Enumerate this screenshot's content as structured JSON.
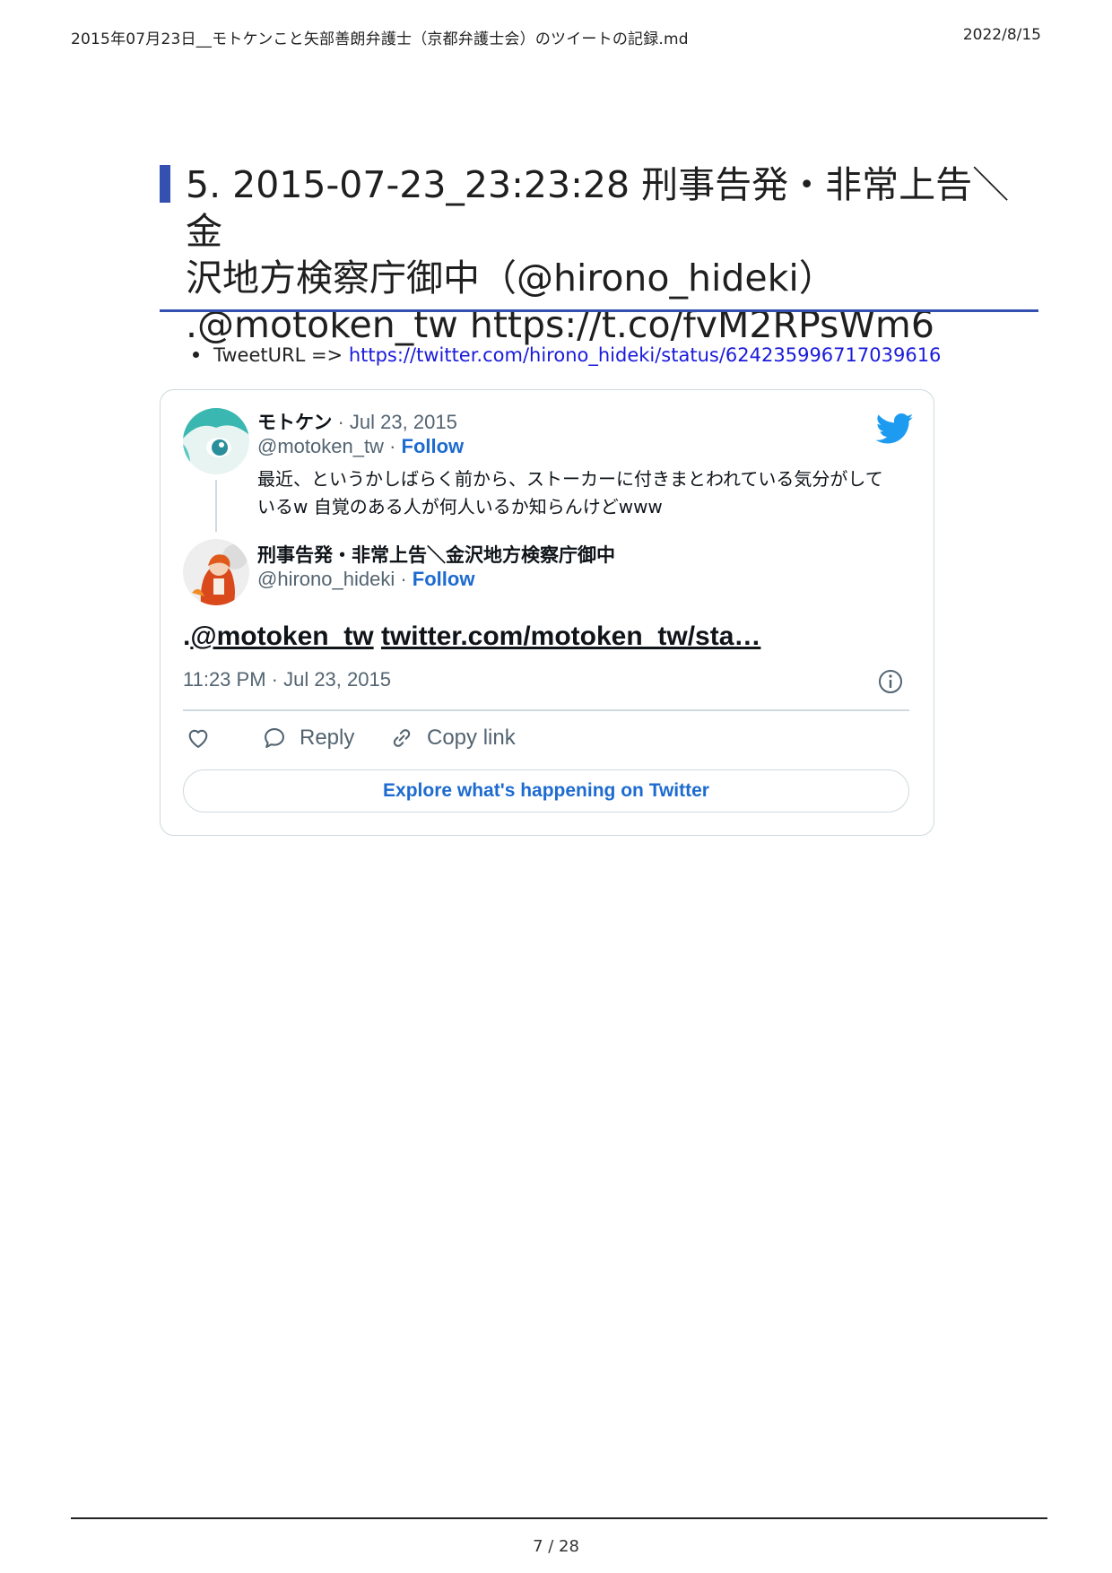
{
  "header": {
    "doc_title": "2015年07月23日__モトケンこと矢部善朗弁護士（京都弁護士会）のツイートの記録.md",
    "date": "2022/8/15"
  },
  "section": {
    "title_line1": "5. 2015-07-23_23:23:28 刑事告発・非常上告＼金",
    "title_line2": "沢地方検察庁御中（@hirono_hideki）",
    "title_line3": ".@motoken_tw https://t.co/fvM2RPsWm6"
  },
  "bullet": {
    "label": "TweetURL => ",
    "url": "https://twitter.com/hirono_hideki/status/624235996717039616"
  },
  "tweet": {
    "quoted": {
      "name": "モトケン",
      "date": " · Jul 23, 2015",
      "handle": "@motoken_tw",
      "sep": " · ",
      "follow": "Follow",
      "text_line1": "最近、というかしばらく前から、ストーカーに付きまとわれている気分がして",
      "text_line2": "いるw  自覚のある人が何人いるか知らんけどwww"
    },
    "author": {
      "name": "刑事告発・非常上告＼金沢地方検察庁御中",
      "handle": "@hirono_hideki",
      "sep": " · ",
      "follow": "Follow"
    },
    "body_prefix": ".",
    "body_mention": "@motoken_tw",
    "body_link": "twitter.com/motoken_tw/sta…",
    "timestamp": "11:23 PM · Jul 23, 2015",
    "actions": {
      "reply": "Reply",
      "copy": "Copy link"
    },
    "explore": "Explore what's happening on Twitter",
    "colors": {
      "link": "#1d6bd0",
      "border": "#cfd9de",
      "muted": "#536471"
    }
  },
  "footer": {
    "page": "7 / 28"
  },
  "colors": {
    "accent": "#3451b2",
    "hyperlink": "#1a1adb"
  }
}
